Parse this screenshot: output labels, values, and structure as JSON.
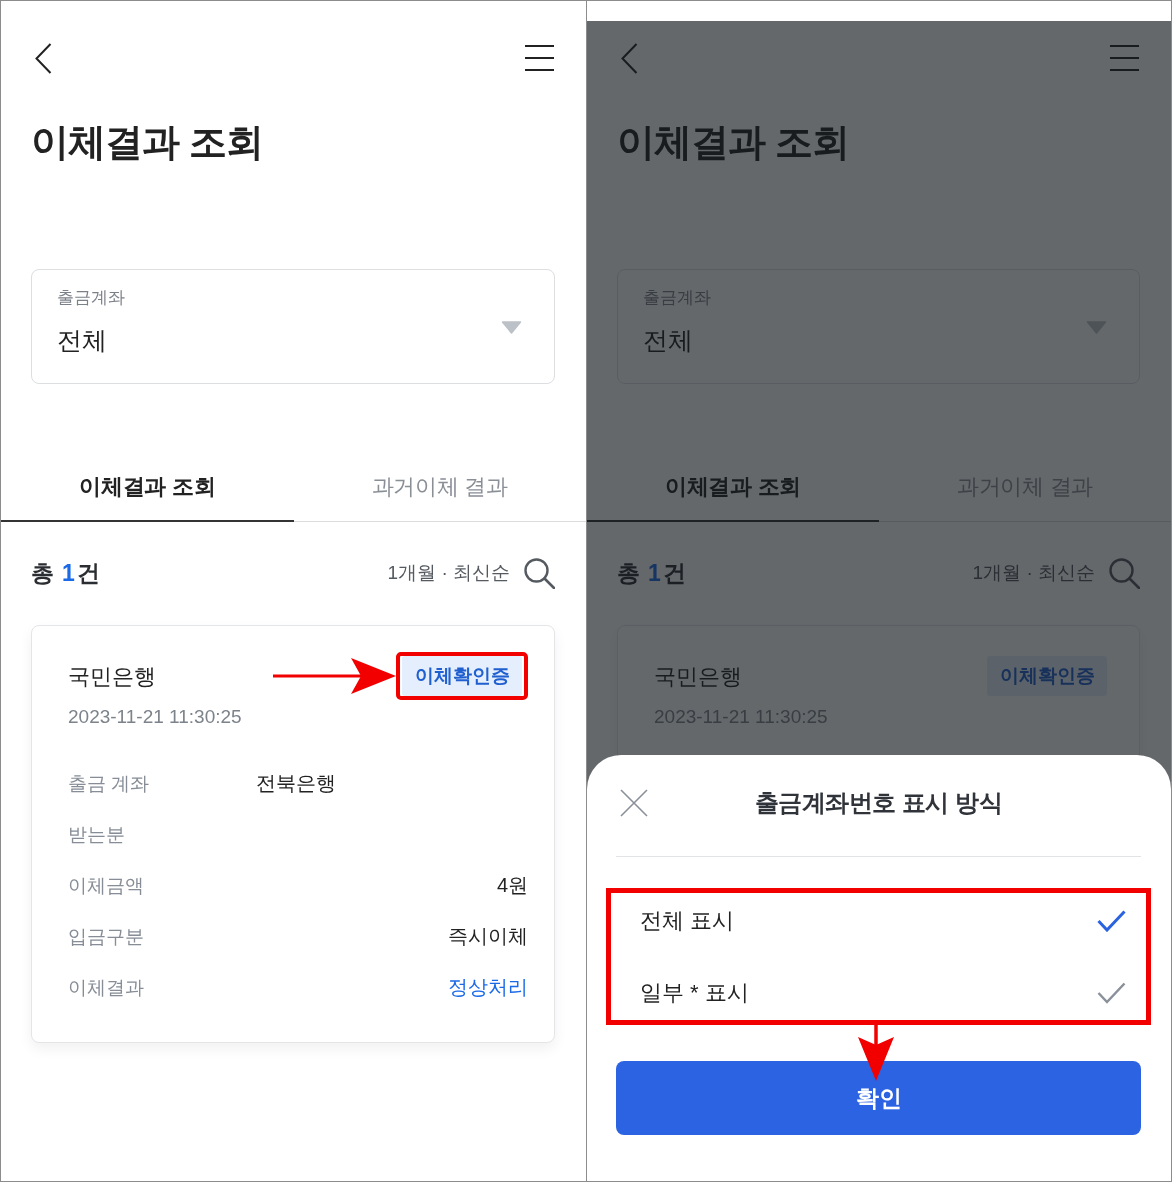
{
  "screens": [
    {
      "dimmed": false,
      "title": "이체결과 조회",
      "account_select": {
        "label": "출금계좌",
        "value": "전체"
      },
      "tabs": [
        {
          "label": "이체결과 조회",
          "selected": true
        },
        {
          "label": "과거이체 결과",
          "selected": false
        }
      ],
      "summary": {
        "prefix": "총",
        "count": "1",
        "suffix": "건",
        "filter": "1개월 · 최신순"
      },
      "card": {
        "bank": "국민은행",
        "datetime": "2023-11-21 11:30:25",
        "badge": {
          "label": "이체확인증",
          "annotated": true
        },
        "rows": [
          {
            "kind": "account",
            "label": "출금 계좌",
            "value": "전북은행"
          },
          {
            "kind": "text",
            "label": "받는분"
          },
          {
            "kind": "text",
            "label": "이체금액",
            "value": "4원"
          },
          {
            "kind": "text",
            "label": "입금구분",
            "value": "즉시이체"
          },
          {
            "kind": "status",
            "label": "이체결과",
            "value": "정상처리"
          }
        ]
      }
    },
    {
      "dimmed": true,
      "title": "이체결과 조회",
      "account_select": {
        "label": "출금계좌",
        "value": "전체"
      },
      "tabs": [
        {
          "label": "이체결과 조회",
          "selected": true
        },
        {
          "label": "과거이체 결과",
          "selected": false
        }
      ],
      "summary": {
        "prefix": "총",
        "count": "1",
        "suffix": "건",
        "filter": "1개월 · 최신순"
      },
      "card": {
        "bank": "국민은행",
        "datetime": "2023-11-21 11:30:25",
        "badge": {
          "label": "이체확인증",
          "annotated": false
        }
      },
      "sheet": {
        "title": "출금계좌번호 표시 방식",
        "options_annotated": true,
        "options": [
          {
            "label": "전체 표시",
            "selected": true
          },
          {
            "label": "일부 * 표시",
            "selected": false
          }
        ],
        "confirm": "확인"
      }
    }
  ]
}
